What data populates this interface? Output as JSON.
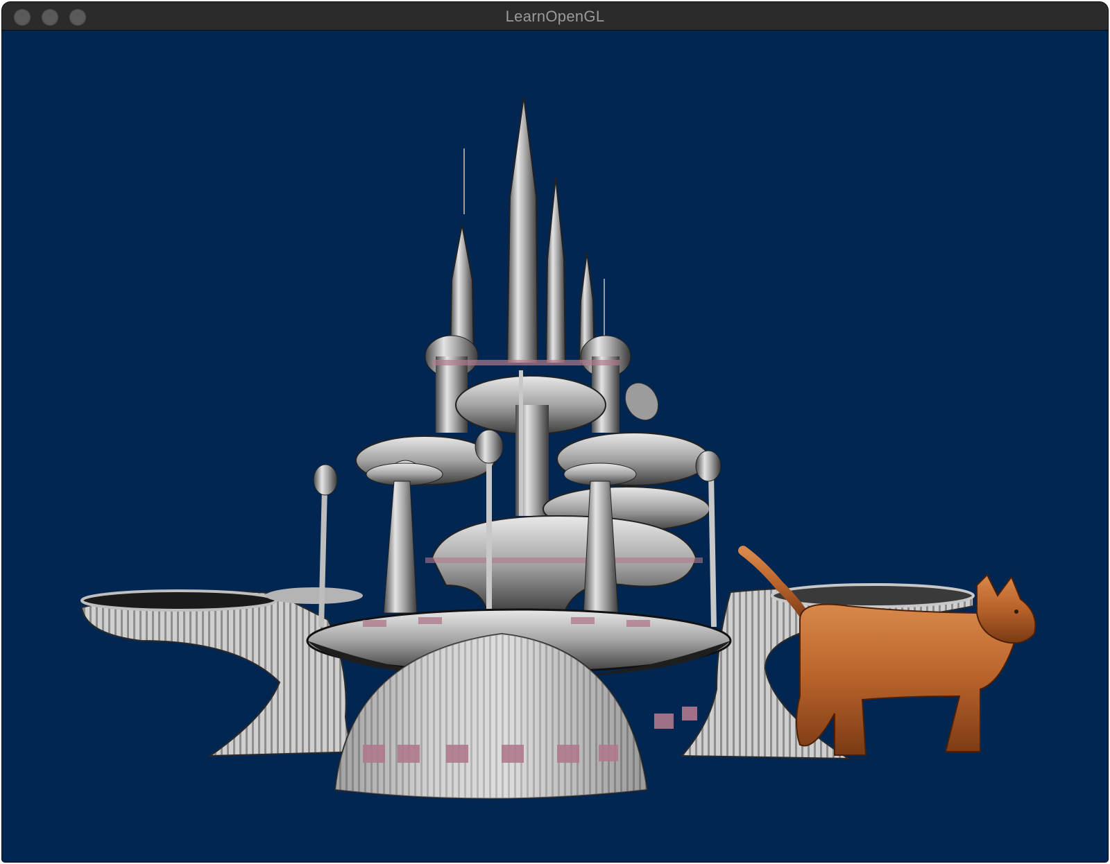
{
  "window": {
    "title": "LearnOpenGL",
    "buttons": [
      "close-button",
      "minimize-button",
      "maximize-button"
    ]
  },
  "scene": {
    "background_color": "#012652",
    "objects": [
      "sci-fi-city-model",
      "cat-model"
    ]
  },
  "colors": {
    "titlebar": "#2b2b2b",
    "title_text": "#9a9a9a",
    "metal_light": "#d8d8d8",
    "metal_mid": "#9b9b9b",
    "metal_dark": "#3c3c3c",
    "accent_pink": "#b07a8e",
    "cat_orange": "#c06a2c"
  }
}
